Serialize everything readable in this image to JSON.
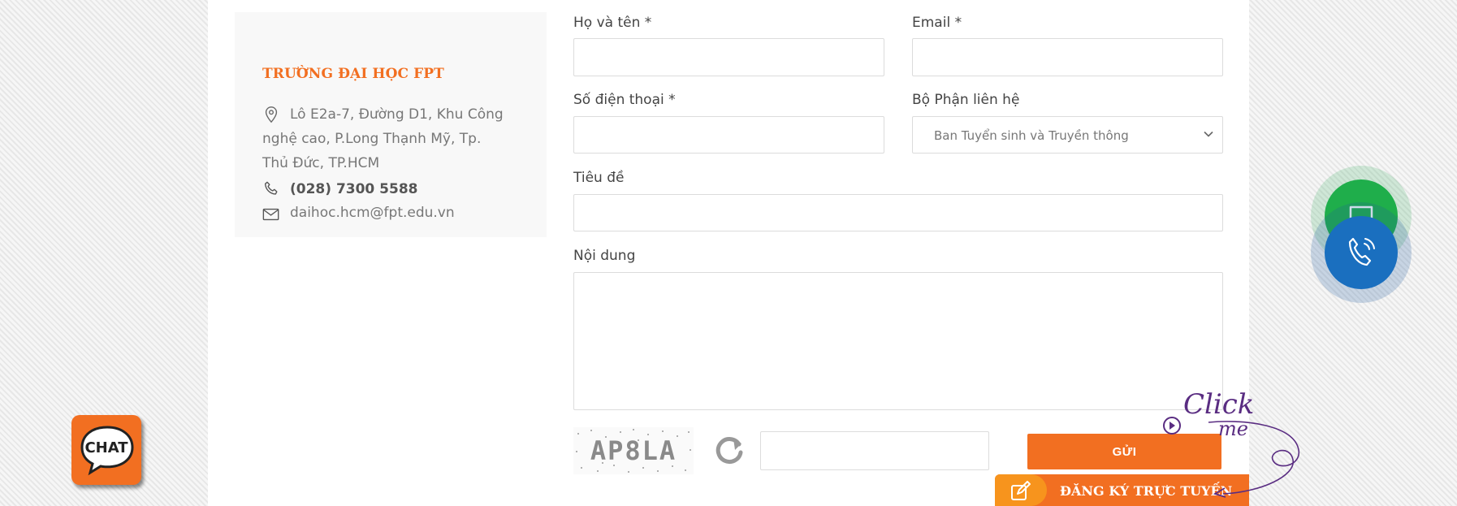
{
  "contact_card": {
    "title": "TRƯỜNG ĐẠI HỌC FPT",
    "address": "Lô E2a-7, Đường D1, Khu Công nghệ cao, P.Long Thạnh Mỹ, Tp. Thủ Đức, TP.HCM",
    "phone": "(028) 7300 5588",
    "email": "daihoc.hcm@fpt.edu.vn",
    "icons": [
      "map-pin-icon",
      "phone-icon",
      "mail-icon"
    ]
  },
  "form": {
    "name_label": "Họ và tên *",
    "email_label": "Email *",
    "phone_label": "Số điện thoại *",
    "department_label": "Bộ Phận liên hệ",
    "department_selected": "Ban Tuyển sinh và Truyền thông",
    "subject_label": "Tiêu đề",
    "content_label": "Nội dung",
    "name_value": "",
    "email_value": "",
    "phone_value": "",
    "subject_value": "",
    "content_value": "",
    "captcha_text": "AP8LA",
    "captcha_value": "",
    "send_label": "GỬI"
  },
  "floating": {
    "register_label": "ĐĂNG KÝ TRỰC TUYẾN",
    "chat_label": "CHAT",
    "click_me_line1": "Click",
    "click_me_line2": "me"
  },
  "colors": {
    "accent": "#f26f21",
    "accent_light": "#f7941d",
    "green_fab": "#1fae4b",
    "blue_fab": "#1a6fbf",
    "click_me": "#5a2d82"
  }
}
